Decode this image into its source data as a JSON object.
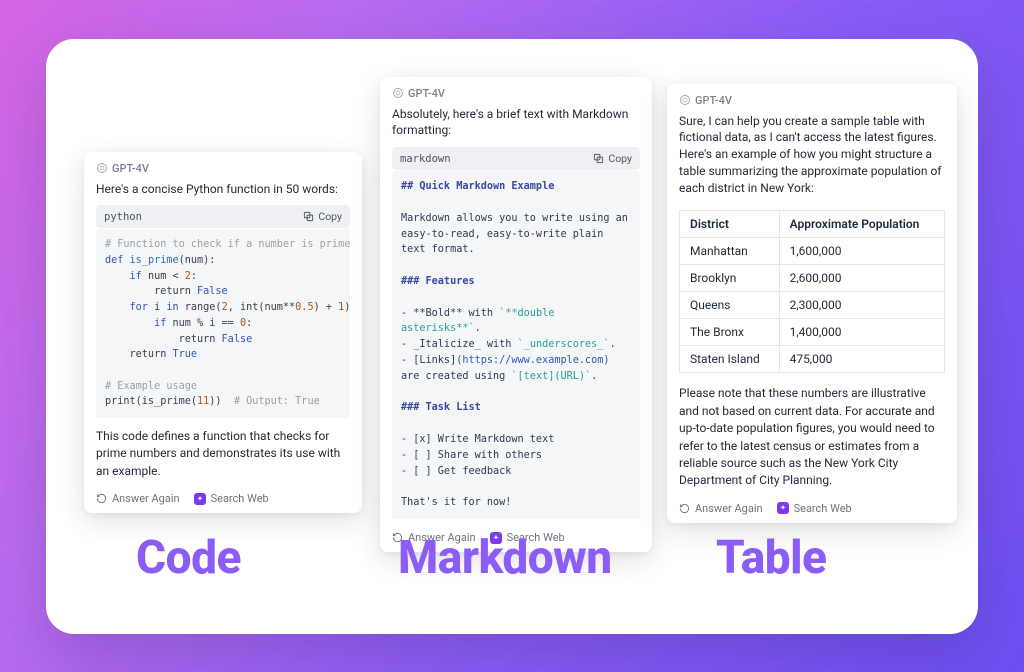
{
  "model_name": "GPT-4V",
  "actions": {
    "answer_again": "Answer Again",
    "search_web": "Search Web",
    "copy": "Copy"
  },
  "labels": {
    "code": "Code",
    "markdown": "Markdown",
    "table": "Table"
  },
  "code_card": {
    "intro": "Here's a concise Python function in 50 words:",
    "lang": "python",
    "line1": "# Function to check if a number is prime",
    "line2a": "def",
    "line2b": " is_prime",
    "line2c": "(num):",
    "line3a": "    if",
    "line3b": " num < ",
    "line3c": "2",
    "line3d": ":",
    "line4a": "        return ",
    "line4b": "False",
    "line5a": "    for",
    "line5b": " i ",
    "line5c": "in",
    "line5d": " range(",
    "line5e": "2",
    "line5f": ", int(num**",
    "line5g": "0.5",
    "line5h": ") + ",
    "line5i": "1",
    "line5j": "):",
    "line6a": "        if",
    "line6b": " num % i == ",
    "line6c": "0",
    "line6d": ":",
    "line7a": "            return ",
    "line7b": "False",
    "line8a": "    return ",
    "line8b": "True",
    "line9": "",
    "line10": "# Example usage",
    "line11a": "print(is_prime(",
    "line11b": "11",
    "line11c": "))  ",
    "line11d": "# Output: True",
    "outro": "This code defines a function that checks for prime numbers and demonstrates its use with an example."
  },
  "md_card": {
    "intro": "Absolutely, here's a brief text with Markdown formatting:",
    "lang": "markdown",
    "h1": "## Quick Markdown Example",
    "para": "Markdown allows you to write using an easy-to-read, easy-to-write plain text format.",
    "h2": "### Features",
    "f1a": "- **Bold** with ",
    "f1b": "`**double asterisks**`",
    "f1c": ".",
    "f2a": "- _Italicize_ with ",
    "f2b": "`_underscores_`",
    "f2c": ".",
    "f3a": "- [Links]",
    "f3b": "(https://www.example.com)",
    "f3c": " are created using ",
    "f3d": "`[text](URL)`",
    "f3e": ".",
    "h3": "### Task List",
    "t1": "- [x] Write Markdown text",
    "t2": "- [ ] Share with others",
    "t3": "- [ ] Get feedback",
    "end": "That's it for now!"
  },
  "table_card": {
    "intro": "Sure, I can help you create a sample table with fictional data, as I can't access the latest figures. Here's an example of how you might structure a table summarizing the approximate population of each district in New York:",
    "col1": "District",
    "col2": "Approximate Population",
    "rows": [
      {
        "d": "Manhattan",
        "p": "1,600,000"
      },
      {
        "d": "Brooklyn",
        "p": "2,600,000"
      },
      {
        "d": "Queens",
        "p": "2,300,000"
      },
      {
        "d": "The Bronx",
        "p": "1,400,000"
      },
      {
        "d": "Staten Island",
        "p": "475,000"
      }
    ],
    "outro": "Please note that these numbers are illustrative and not based on current data. For accurate and up-to-date population figures, you would need to refer to the latest census or estimates from a reliable source such as the New York City Department of City Planning."
  }
}
